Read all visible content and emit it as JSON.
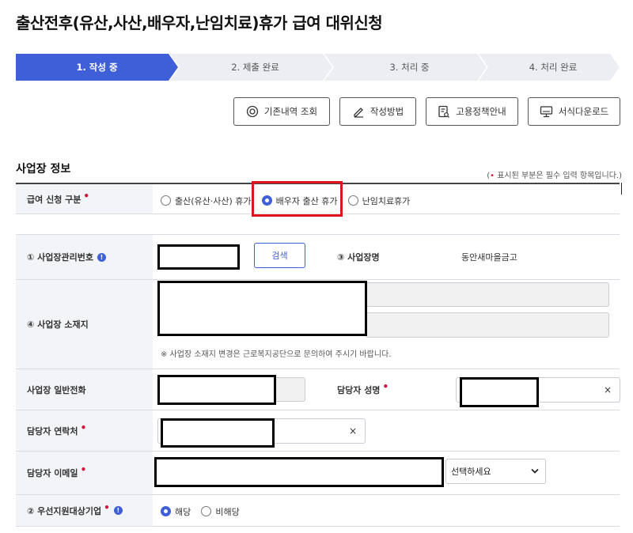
{
  "page_title": "출산전후(유산,사산,배우자,난임치료)휴가 급여 대위신청",
  "steps": [
    {
      "label": "1. 작성 중",
      "state": "active"
    },
    {
      "label": "2. 제출 완료",
      "state": "inactive"
    },
    {
      "label": "3. 처리 중",
      "state": "inactive"
    },
    {
      "label": "4. 처리 완료",
      "state": "inactive"
    }
  ],
  "actions": {
    "history": {
      "label": "기존내역 조회",
      "icon": "search-icon"
    },
    "howto": {
      "label": "작성방법",
      "icon": "pencil-icon"
    },
    "policy": {
      "label": "고용정책안내",
      "icon": "document-search-icon"
    },
    "download": {
      "label": "서식다운로드",
      "icon": "monitor-icon"
    }
  },
  "section": {
    "title": "사업장 정보",
    "required_note_prefix": "(",
    "required_note_dot": "•",
    "required_note": " 표시된 부분은 필수 입력 항목입니다.)"
  },
  "form": {
    "claim_type": {
      "label": "급여 신청 구분",
      "required": true,
      "options": [
        {
          "label": "출산(유산·사산) 휴가",
          "selected": false
        },
        {
          "label": "배우자 출산 휴가",
          "selected": true
        },
        {
          "label": "난임치료휴가",
          "selected": false
        }
      ]
    },
    "biz_mgmt_no": {
      "label": "① 사업장관리번호",
      "value": "",
      "search_label": "검색",
      "info_icon": "info-icon"
    },
    "biz_name": {
      "label": "③ 사업장명",
      "value": "동안새마을금고"
    },
    "biz_address": {
      "label": "④ 사업장 소재지",
      "hint": "※ 사업장 소재지 변경은 근로복지공단으로 문의하여 주시기 바랍니다."
    },
    "biz_phone": {
      "label": "사업장 일반전화",
      "value": ""
    },
    "manager_name": {
      "label": "담당자 성명",
      "required": true,
      "value": "",
      "clear_icon": "×"
    },
    "manager_phone": {
      "label": "담당자 연락처",
      "required": true,
      "value": "",
      "clear_icon": "×"
    },
    "manager_email": {
      "label": "담당자 이메일",
      "required": true,
      "value": "",
      "domain_select": "선택하세요"
    },
    "priority_company": {
      "label": "② 우선지원대상기업",
      "required": true,
      "info_icon": "info-icon",
      "options": [
        {
          "label": "해당",
          "selected": true
        },
        {
          "label": "비해당",
          "selected": false
        }
      ]
    }
  },
  "colors": {
    "accent": "#3f5fd8",
    "required": "#d0143c",
    "highlight": "#e0121e"
  }
}
